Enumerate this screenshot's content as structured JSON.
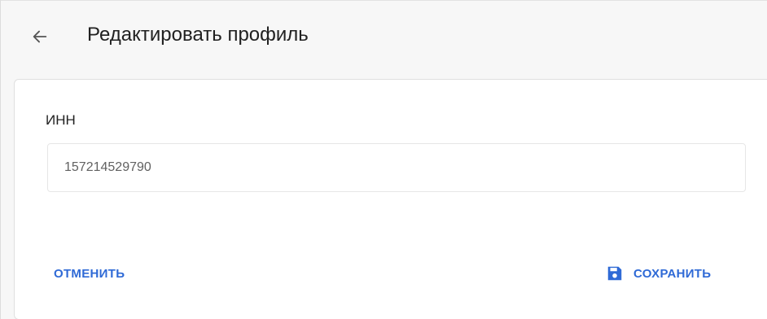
{
  "header": {
    "back_icon": "arrow-left-icon",
    "title": "Редактировать профиль"
  },
  "form": {
    "inn": {
      "label": "ИНН",
      "value": "157214529790"
    }
  },
  "actions": {
    "cancel_label": "ОТМЕНИТЬ",
    "save_label": "СОХРАНИТЬ",
    "save_icon": "floppy-disk-icon"
  },
  "colors": {
    "accent": "#2f6ad6",
    "text_primary": "#212121",
    "background": "#f7f7f7"
  }
}
